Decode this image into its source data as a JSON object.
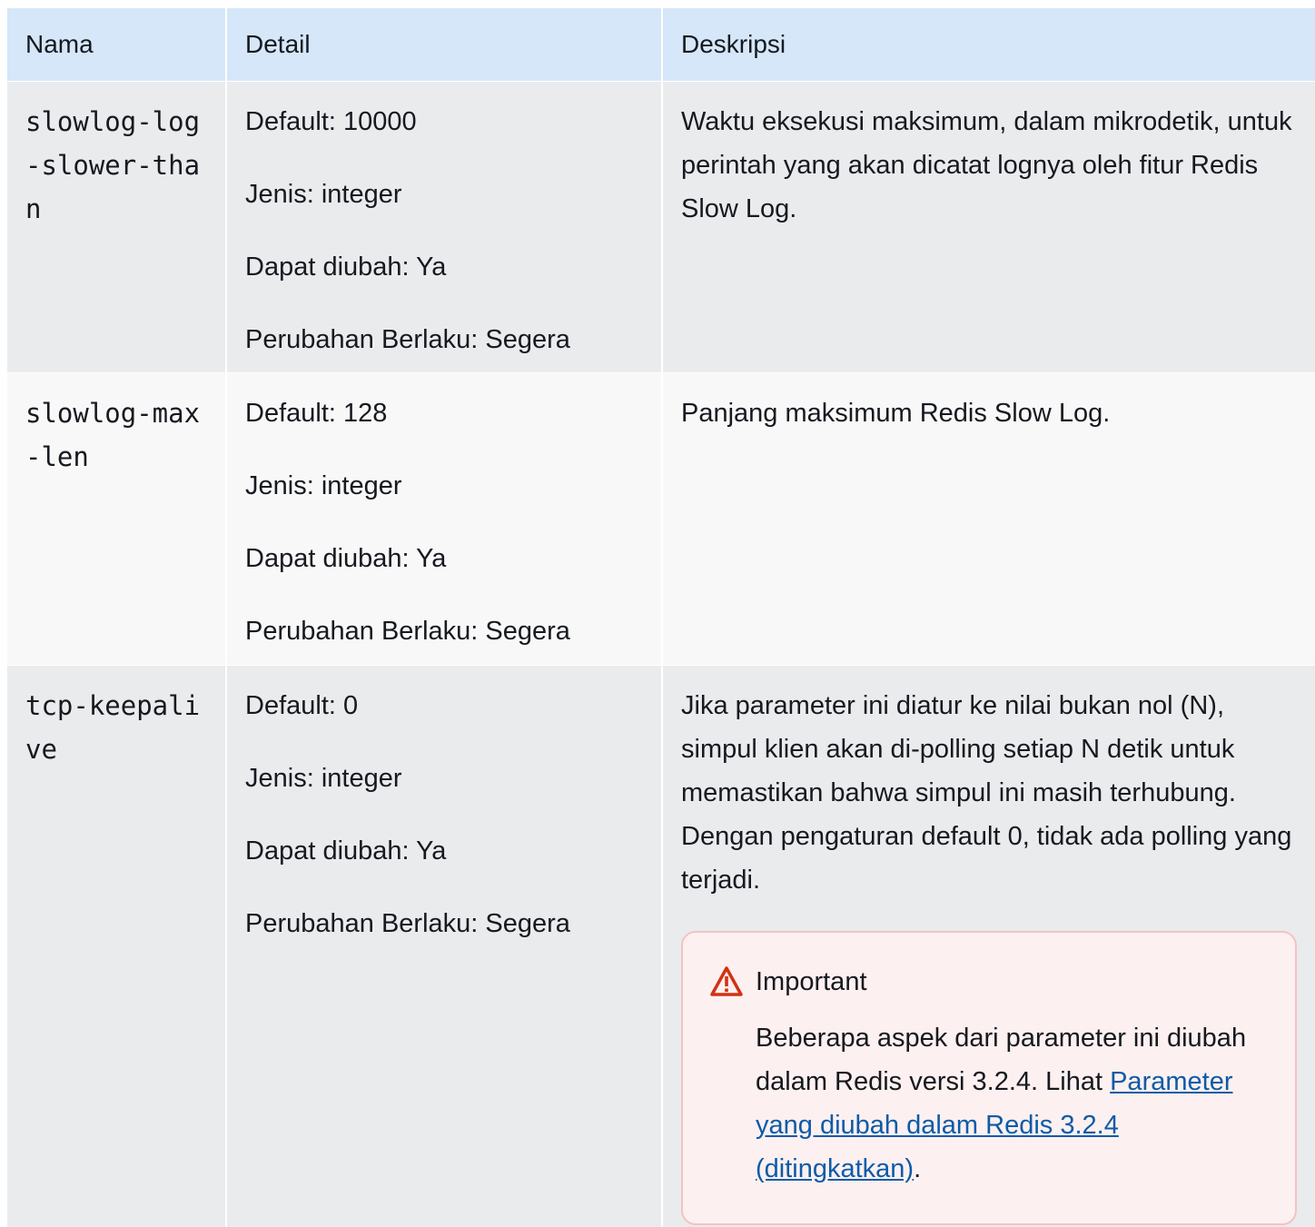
{
  "table": {
    "headers": {
      "name": "Nama",
      "detail": "Detail",
      "description": "Deskripsi"
    },
    "rows": [
      {
        "name": "slowlog-log-slower-than",
        "details": [
          "Default: 10000",
          "Jenis: integer",
          "Dapat diubah: Ya",
          "Perubahan Berlaku: Segera"
        ],
        "description": "Waktu eksekusi maksimum, dalam mikrodetik, untuk perintah yang akan dicatat lognya oleh fitur Redis Slow Log."
      },
      {
        "name": "slowlog-max-len",
        "details": [
          "Default: 128",
          "Jenis: integer",
          "Dapat diubah: Ya",
          "Perubahan Berlaku: Segera"
        ],
        "description": "Panjang maksimum Redis Slow Log."
      },
      {
        "name": "tcp-keepalive",
        "details": [
          "Default: 0",
          "Jenis: integer",
          "Dapat diubah: Ya",
          "Perubahan Berlaku: Segera"
        ],
        "description": "Jika parameter ini diatur ke nilai bukan nol (N), simpul klien akan di-polling setiap N detik untuk memastikan bahwa simpul ini masih terhubung. Dengan pengaturan default 0, tidak ada polling yang terjadi.",
        "alert": {
          "icon": "warning-triangle-icon",
          "title": "Important",
          "text_before": "Beberapa aspek dari parameter ini diubah dalam Redis versi 3.2.4. Lihat ",
          "link_text": "Parameter yang diubah dalam Redis 3.2.4 (ditingkatkan)",
          "text_after": "."
        }
      }
    ]
  },
  "colors": {
    "header_bg": "#d5e7f8",
    "row_odd_bg": "#e9ebed",
    "row_even_bg": "#f8f8f8",
    "alert_bg": "#fdf0f0",
    "alert_border": "#f4c3c3",
    "warning_red": "#d13212",
    "link": "#0b5ba8"
  }
}
